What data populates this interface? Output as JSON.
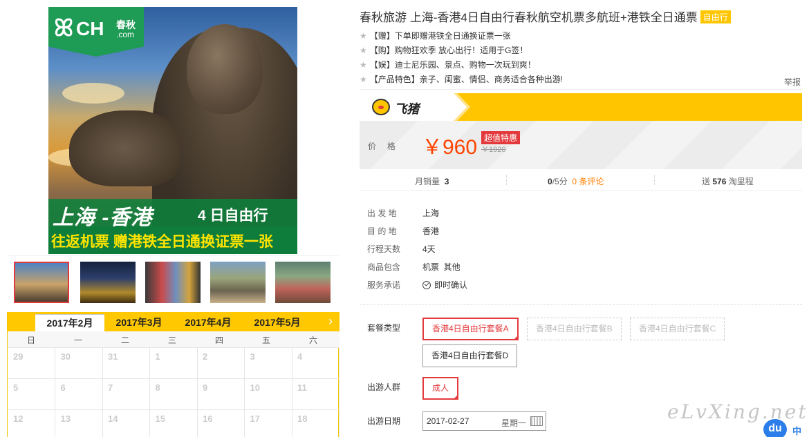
{
  "product": {
    "title": "春秋旅游 上海-香港4日自由行春秋航空机票多航班+港铁全日通票",
    "tag": "自由行",
    "image_logo": {
      "ch": "CH",
      "cn": "春秋",
      "com": ".com"
    },
    "image_banner_big": "上海 -香港",
    "image_banner_small": "4 日自由行",
    "image_banner_line2": "往返机票 赠港铁全日通换证票一张"
  },
  "promos": [
    "【赠】下单即赠港铁全日通换证票一张",
    "【购】购物狂欢季 放心出行！适用于G签！",
    "【娱】迪士尼乐园、景点、购物一次玩到爽！",
    "【产品特色】亲子、闺蜜、情侣、商务适合各种出游!"
  ],
  "report": "举报",
  "platform": {
    "name": "飞猪",
    "icon": "fliggy-pig-icon"
  },
  "price": {
    "label": "价格",
    "current": "￥960",
    "badge": "超值特惠",
    "original": "￥1920"
  },
  "stats": {
    "monthly_label": "月销量",
    "monthly_value": "3",
    "rating": "0",
    "rating_suffix": "/5分",
    "reviews": "0 条评论",
    "points_prefix": "送",
    "points": "576",
    "points_suffix": "淘里程"
  },
  "attributes": [
    {
      "key": "出 发 地",
      "value": "上海"
    },
    {
      "key": "目 的 地",
      "value": "香港"
    },
    {
      "key": "行程天数",
      "value": "4天"
    },
    {
      "key": "商品包含",
      "value": "机票  其他"
    },
    {
      "key": "服务承诺",
      "value": "即时确认"
    }
  ],
  "options": {
    "package_label": "套餐类型",
    "packages": [
      "香港4日自由行套餐A",
      "香港4日自由行套餐B",
      "香港4日自由行套餐C",
      "香港4日自由行套餐D"
    ],
    "traveler_label": "出游人群",
    "traveler": "成人",
    "date_label": "出游日期",
    "date_value": "2017-02-27",
    "date_weekday": "星期一"
  },
  "calendar": {
    "months": [
      "2017年2月",
      "2017年3月",
      "2017年4月",
      "2017年5月"
    ],
    "active_month": 0,
    "next": "›",
    "weekdays": [
      "日",
      "一",
      "二",
      "三",
      "四",
      "五",
      "六"
    ],
    "days": [
      "29",
      "30",
      "31",
      "1",
      "2",
      "3",
      "4",
      "5",
      "6",
      "7",
      "8",
      "9",
      "10",
      "11",
      "12",
      "13",
      "14",
      "15",
      "16",
      "17",
      "18"
    ]
  },
  "watermark": "eLvXing.net",
  "ime": {
    "du": "du",
    "lang": "中"
  },
  "colors": {
    "accent": "#e4393c",
    "price": "#ff4400",
    "brand": "#ffc600",
    "green": "#1e9b55"
  }
}
